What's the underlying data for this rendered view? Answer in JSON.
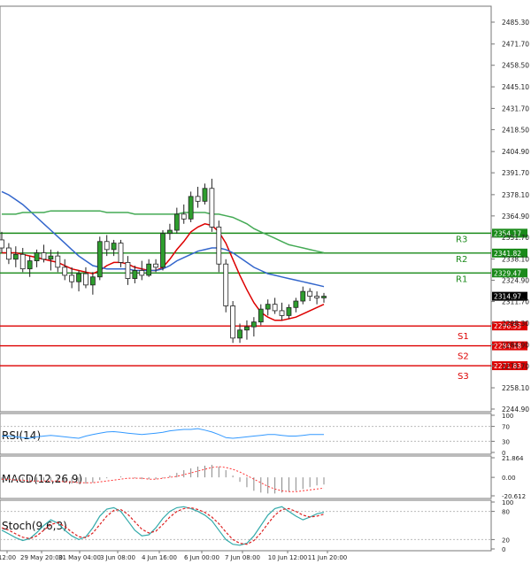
{
  "chart_data": [
    {
      "type": "candlestick",
      "panel": "price",
      "y_ticks": [
        "2485.30",
        "2471.70",
        "2458.50",
        "2445.10",
        "2431.70",
        "2418.50",
        "2404.90",
        "2391.70",
        "2378.10",
        "2364.90",
        "2351.70",
        "2338.10",
        "2324.90",
        "2311.70",
        "2298.30",
        "2284.90",
        "2271.70",
        "2258.10",
        "2244.90"
      ],
      "ylim": [
        2244.9,
        2485.3
      ],
      "x_tick_labels": [
        "12:00",
        "29 May 20:00",
        "31 May 04:00",
        "3 Jun 08:00",
        "4 Jun 16:00",
        "6 Jun 00:00",
        "7 Jun 08:00",
        "10 Jun 12:00",
        "11 Jun 20:00"
      ],
      "current_price": "2314.97",
      "levels": [
        {
          "name": "R3",
          "value": "2354.17",
          "color": "#1a8a1a"
        },
        {
          "name": "R2",
          "value": "2341.82",
          "color": "#1a8a1a"
        },
        {
          "name": "R1",
          "value": "2329.47",
          "color": "#1a8a1a"
        },
        {
          "name": "S1",
          "value": "2296.53",
          "color": "#dd0000"
        },
        {
          "name": "S2",
          "value": "2284.18",
          "color": "#dd0000"
        },
        {
          "name": "S3",
          "value": "2271.83",
          "color": "#dd0000"
        }
      ],
      "candles": [
        {
          "o": 2350,
          "h": 2355,
          "l": 2342,
          "c": 2345
        },
        {
          "o": 2345,
          "h": 2348,
          "l": 2335,
          "c": 2338
        },
        {
          "o": 2338,
          "h": 2346,
          "l": 2333,
          "c": 2341
        },
        {
          "o": 2341,
          "h": 2345,
          "l": 2330,
          "c": 2332
        },
        {
          "o": 2332,
          "h": 2340,
          "l": 2327,
          "c": 2337
        },
        {
          "o": 2337,
          "h": 2344,
          "l": 2333,
          "c": 2342
        },
        {
          "o": 2342,
          "h": 2347,
          "l": 2336,
          "c": 2338
        },
        {
          "o": 2338,
          "h": 2344,
          "l": 2331,
          "c": 2340
        },
        {
          "o": 2340,
          "h": 2343,
          "l": 2330,
          "c": 2333
        },
        {
          "o": 2333,
          "h": 2338,
          "l": 2325,
          "c": 2328
        },
        {
          "o": 2328,
          "h": 2333,
          "l": 2320,
          "c": 2324
        },
        {
          "o": 2324,
          "h": 2331,
          "l": 2318,
          "c": 2329
        },
        {
          "o": 2329,
          "h": 2333,
          "l": 2320,
          "c": 2322
        },
        {
          "o": 2322,
          "h": 2330,
          "l": 2316,
          "c": 2327
        },
        {
          "o": 2327,
          "h": 2352,
          "l": 2325,
          "c": 2349
        },
        {
          "o": 2349,
          "h": 2353,
          "l": 2340,
          "c": 2344
        },
        {
          "o": 2344,
          "h": 2350,
          "l": 2340,
          "c": 2348
        },
        {
          "o": 2348,
          "h": 2350,
          "l": 2333,
          "c": 2336
        },
        {
          "o": 2336,
          "h": 2340,
          "l": 2322,
          "c": 2326
        },
        {
          "o": 2326,
          "h": 2334,
          "l": 2323,
          "c": 2331
        },
        {
          "o": 2331,
          "h": 2337,
          "l": 2325,
          "c": 2328
        },
        {
          "o": 2328,
          "h": 2338,
          "l": 2327,
          "c": 2335
        },
        {
          "o": 2335,
          "h": 2338,
          "l": 2330,
          "c": 2333
        },
        {
          "o": 2333,
          "h": 2356,
          "l": 2331,
          "c": 2354
        },
        {
          "o": 2354,
          "h": 2360,
          "l": 2350,
          "c": 2356
        },
        {
          "o": 2356,
          "h": 2370,
          "l": 2354,
          "c": 2366
        },
        {
          "o": 2366,
          "h": 2372,
          "l": 2360,
          "c": 2363
        },
        {
          "o": 2363,
          "h": 2380,
          "l": 2361,
          "c": 2377
        },
        {
          "o": 2377,
          "h": 2383,
          "l": 2370,
          "c": 2374
        },
        {
          "o": 2374,
          "h": 2385,
          "l": 2372,
          "c": 2382
        },
        {
          "o": 2382,
          "h": 2388,
          "l": 2355,
          "c": 2358
        },
        {
          "o": 2358,
          "h": 2362,
          "l": 2330,
          "c": 2335
        },
        {
          "o": 2335,
          "h": 2338,
          "l": 2305,
          "c": 2309
        },
        {
          "o": 2309,
          "h": 2312,
          "l": 2286,
          "c": 2289
        },
        {
          "o": 2289,
          "h": 2298,
          "l": 2286,
          "c": 2294
        },
        {
          "o": 2294,
          "h": 2300,
          "l": 2288,
          "c": 2296
        },
        {
          "o": 2296,
          "h": 2302,
          "l": 2290,
          "c": 2299
        },
        {
          "o": 2299,
          "h": 2310,
          "l": 2297,
          "c": 2307
        },
        {
          "o": 2307,
          "h": 2313,
          "l": 2303,
          "c": 2310
        },
        {
          "o": 2310,
          "h": 2314,
          "l": 2304,
          "c": 2306
        },
        {
          "o": 2306,
          "h": 2311,
          "l": 2300,
          "c": 2303
        },
        {
          "o": 2303,
          "h": 2310,
          "l": 2301,
          "c": 2308
        },
        {
          "o": 2308,
          "h": 2314,
          "l": 2305,
          "c": 2312
        },
        {
          "o": 2312,
          "h": 2321,
          "l": 2310,
          "c": 2318
        },
        {
          "o": 2318,
          "h": 2320,
          "l": 2312,
          "c": 2315
        },
        {
          "o": 2315,
          "h": 2318,
          "l": 2310,
          "c": 2314
        },
        {
          "o": 2314,
          "h": 2317,
          "l": 2311,
          "c": 2315
        }
      ],
      "series": [
        {
          "color": "#dd0000",
          "values": [
            2342,
            2342,
            2342,
            2341,
            2340,
            2339,
            2338,
            2337,
            2336,
            2334,
            2332,
            2331,
            2330,
            2329,
            2331,
            2334,
            2336,
            2336,
            2335,
            2333,
            2332,
            2331,
            2331,
            2333,
            2338,
            2344,
            2349,
            2355,
            2358,
            2360,
            2359,
            2355,
            2348,
            2338,
            2328,
            2319,
            2311,
            2305,
            2302,
            2300,
            2300,
            2301,
            2302,
            2304,
            2306,
            2308,
            2310
          ]
        },
        {
          "color": "#3366cc",
          "values": [
            2380,
            2378,
            2375,
            2372,
            2368,
            2364,
            2360,
            2356,
            2352,
            2348,
            2344,
            2340,
            2337,
            2334,
            2333,
            2332,
            2332,
            2332,
            2332,
            2331,
            2331,
            2331,
            2331,
            2332,
            2334,
            2337,
            2339,
            2341,
            2343,
            2344,
            2345,
            2345,
            2344,
            2342,
            2339,
            2336,
            2333,
            2331,
            2329,
            2328,
            2327,
            2326,
            2325,
            2324,
            2323,
            2322,
            2321
          ]
        },
        {
          "color": "#44aa55",
          "values": [
            2366,
            2366,
            2366,
            2367,
            2367,
            2367,
            2367,
            2368,
            2368,
            2368,
            2368,
            2368,
            2368,
            2368,
            2368,
            2367,
            2367,
            2367,
            2367,
            2366,
            2366,
            2366,
            2366,
            2366,
            2366,
            2366,
            2367,
            2367,
            2367,
            2367,
            2366,
            2366,
            2365,
            2364,
            2362,
            2360,
            2357,
            2355,
            2353,
            2351,
            2349,
            2347,
            2346,
            2345,
            2344,
            2343,
            2342
          ]
        }
      ]
    },
    {
      "type": "line",
      "panel": "rsi",
      "title": "RSI(14)",
      "y_ticks": [
        "100",
        "70",
        "30",
        "0"
      ],
      "ylim": [
        0,
        100
      ],
      "series": [
        {
          "color": "#3399ff",
          "values": [
            44,
            44,
            42,
            40,
            38,
            42,
            44,
            46,
            44,
            42,
            40,
            38,
            44,
            48,
            52,
            55,
            56,
            54,
            52,
            50,
            48,
            50,
            52,
            54,
            58,
            60,
            62,
            62,
            64,
            60,
            55,
            48,
            40,
            38,
            40,
            42,
            44,
            46,
            48,
            48,
            46,
            44,
            44,
            46,
            48,
            48,
            48
          ]
        }
      ]
    },
    {
      "type": "bar",
      "panel": "macd",
      "title": "MACD(12,26,9)",
      "y_ticks": [
        "21.864",
        "0.00",
        "-20.612"
      ],
      "ylim": [
        -20.612,
        21.864
      ],
      "values": [
        -3,
        -3,
        -4,
        -4,
        -5,
        -5,
        -4,
        -4,
        -5,
        -6,
        -7,
        -7,
        -7,
        -6,
        -3,
        -1,
        0,
        1,
        0,
        -1,
        -2,
        -2,
        -2,
        -1,
        2,
        5,
        8,
        10,
        12,
        13,
        14,
        12,
        8,
        2,
        -5,
        -11,
        -15,
        -17,
        -18,
        -18,
        -17,
        -16,
        -15,
        -13,
        -11,
        -9,
        -8
      ],
      "series": [
        {
          "color": "#ff3333",
          "values": [
            -2,
            -2,
            -3,
            -3,
            -4,
            -4,
            -4,
            -4,
            -4,
            -5,
            -5,
            -6,
            -6,
            -6,
            -5,
            -4,
            -3,
            -2,
            -1,
            -1,
            -1,
            -2,
            -2,
            -1,
            0,
            1,
            3,
            5,
            7,
            9,
            11,
            12,
            11,
            9,
            6,
            2,
            -2,
            -6,
            -10,
            -13,
            -15,
            -16,
            -16,
            -15,
            -14,
            -13,
            -12
          ]
        }
      ]
    },
    {
      "type": "line",
      "panel": "stoch",
      "title": "Stoch(9,6,3)",
      "y_ticks": [
        "100",
        "80",
        "20",
        "0"
      ],
      "ylim": [
        0,
        100
      ],
      "series": [
        {
          "color": "#33aaaa",
          "values": [
            40,
            32,
            24,
            18,
            22,
            35,
            50,
            62,
            55,
            40,
            28,
            20,
            26,
            45,
            70,
            85,
            88,
            80,
            60,
            40,
            28,
            30,
            45,
            65,
            80,
            88,
            90,
            86,
            80,
            72,
            60,
            40,
            20,
            10,
            8,
            12,
            28,
            50,
            72,
            86,
            90,
            80,
            70,
            62,
            68,
            75,
            78
          ]
        },
        {
          "color": "#dd2222",
          "values": [
            45,
            40,
            32,
            25,
            22,
            28,
            40,
            52,
            56,
            48,
            36,
            26,
            24,
            34,
            52,
            70,
            82,
            84,
            74,
            58,
            42,
            34,
            38,
            52,
            68,
            80,
            86,
            88,
            84,
            78,
            68,
            54,
            36,
            20,
            12,
            10,
            18,
            34,
            54,
            72,
            84,
            86,
            80,
            72,
            68,
            70,
            74
          ]
        }
      ]
    }
  ]
}
